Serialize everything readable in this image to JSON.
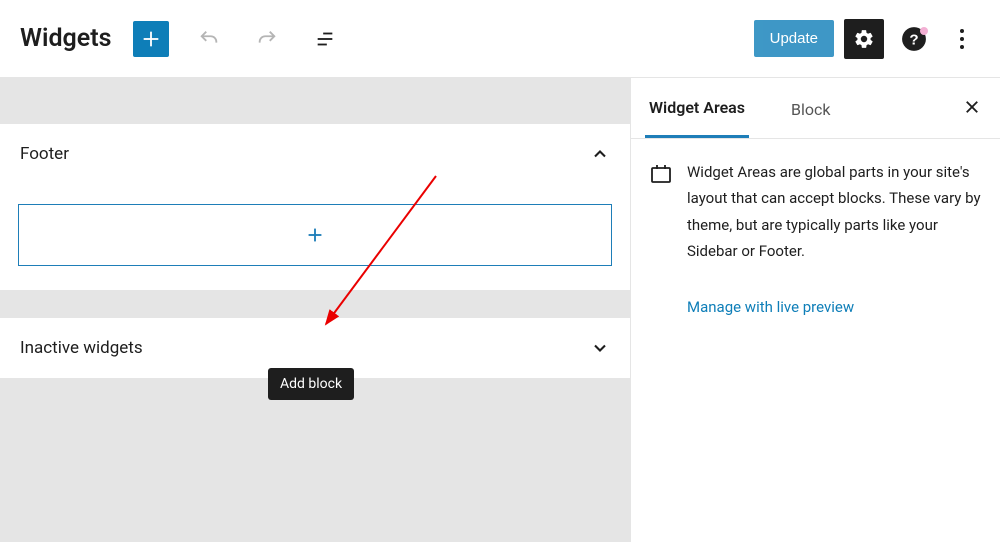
{
  "header": {
    "title": "Widgets",
    "update_label": "Update"
  },
  "main": {
    "panels": {
      "footer_label": "Footer",
      "inactive_label": "Inactive widgets"
    },
    "tooltip": "Add block"
  },
  "sidebar": {
    "tabs": {
      "areas": "Widget Areas",
      "block": "Block"
    },
    "description": "Widget Areas are global parts in your site's layout that can accept blocks. These vary by theme, but are typically parts like your Sidebar or Footer.",
    "manage_link": "Manage with live preview"
  }
}
